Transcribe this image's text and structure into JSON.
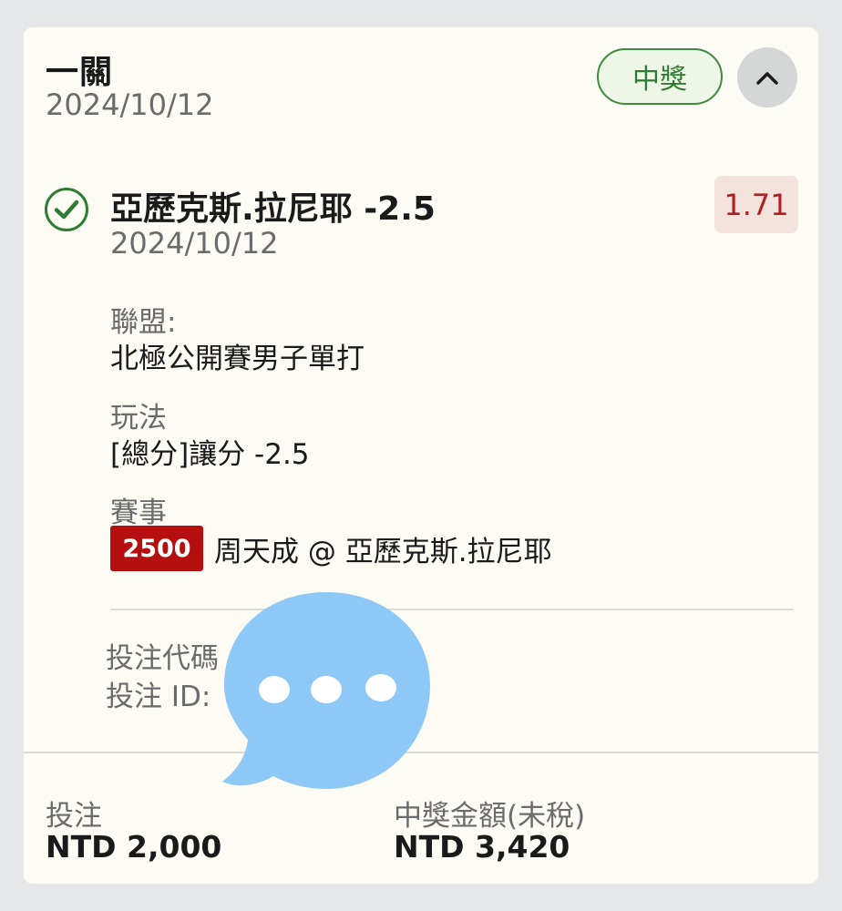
{
  "ticket": {
    "title": "一關",
    "date": "2024/10/12",
    "status": "中獎",
    "collapse_icon": "chevron-up-icon"
  },
  "selection": {
    "status_icon": "check-circle-icon",
    "name": "亞歷克斯.拉尼耶 -2.5",
    "date": "2024/10/12",
    "odds": "1.71",
    "league_label": "聯盟:",
    "league": "北極公開賽男子單打",
    "play_label": "玩法",
    "play": "[總分]讓分 -2.5",
    "event_label": "賽事",
    "event_code": "2500",
    "event_name": "周天成 @ 亞歷克斯.拉尼耶"
  },
  "bet_info": {
    "code_label": "投注代碼",
    "id_label": "投注 ID:"
  },
  "footer": {
    "stake_label": "投注",
    "stake_value": "NTD 2,000",
    "payout_label": "中獎金額(未稅)",
    "payout_value": "NTD 3,420"
  },
  "overlay": {
    "icon": "chat-bubble-icon"
  },
  "colors": {
    "win_green": "#2f7d32",
    "odds_red": "#b02020",
    "code_red": "#b50f0f",
    "overlay_blue": "#8ec8f6"
  }
}
